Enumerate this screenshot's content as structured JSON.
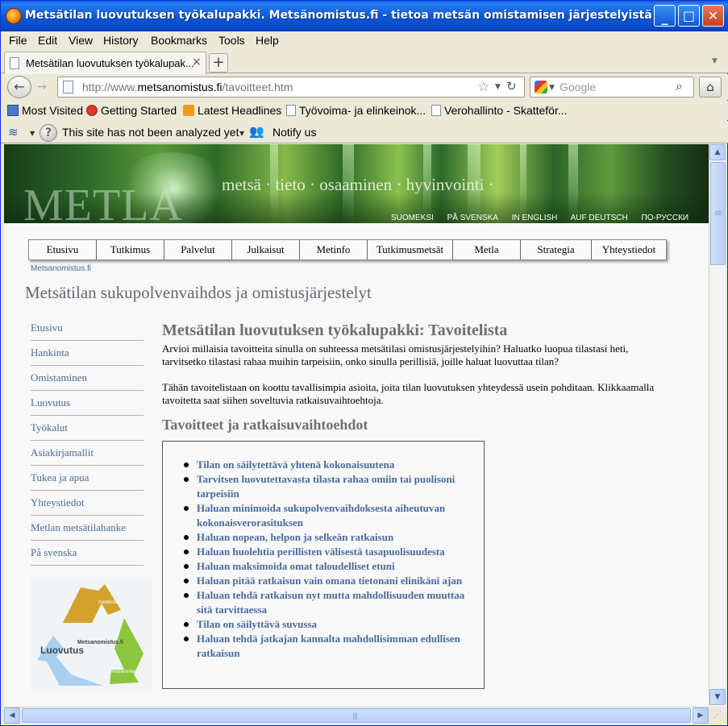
{
  "window": {
    "title": "Metsätilan luovutuksen työkalupakki. Metsänomistus.fi - tietoa metsän omistamisen järjestelyistä - M...",
    "min_glyph": "_",
    "max_glyph": "□",
    "close_glyph": "✕"
  },
  "menu": [
    "File",
    "Edit",
    "View",
    "History",
    "Bookmarks",
    "Tools",
    "Help"
  ],
  "tabs": [
    {
      "label": "Metsätilan luovutuksen työkalupak...",
      "close": "×"
    }
  ],
  "new_tab": "+",
  "navbar": {
    "back": "←",
    "forward": "→",
    "url_prefix": "http://www.",
    "url_domain": "metsanomistus.fi",
    "url_path": "/tavoitteet.htm",
    "star": "☆",
    "reload": "↻",
    "search_placeholder": "Google",
    "search_icon": "⌕",
    "home": "⌂"
  },
  "bookmarks": [
    "Most Visited",
    "Getting Started",
    "Latest Headlines",
    "Työvoima- ja elinkeinok...",
    "Verohallinto - Skatteför..."
  ],
  "addon_bar": {
    "wot_icon": "wifi-icon",
    "status": "This site has not been analyzed yet",
    "notify": "Notify us"
  },
  "banner": {
    "logo": "METLA",
    "tagline": "metsä  ·  tieto  ·  osaaminen  ·  hyvinvointi  ·",
    "languages": [
      "SUOMEKSI",
      "PÅ SVENSKA",
      "IN ENGLISH",
      "AUF DEUTSCH",
      "ПО-РУССКИ"
    ]
  },
  "topnav": [
    "Etusivu",
    "Tutkimus",
    "Palvelut",
    "Julkaisut",
    "Metinfo",
    "Tutkimusmetsät",
    "Metla",
    "Strategia",
    "Yhteystiedot"
  ],
  "breadcrumb": "Metsanomistus.fi",
  "site_title": "Metsätilan sukupolvenvaihdos ja omistusjärjestelyt",
  "sidenav": [
    "Etusivu",
    "Hankinta",
    "Omistaminen",
    "Luovutus",
    "Työkalut",
    "Asiakirjamallit",
    "Tukea ja apua",
    "Yhteystiedot",
    "Metlan metsätilahanke",
    "På svenska"
  ],
  "cycle_logo": {
    "center": "Metsanomistus.fi",
    "hankinta": "Hankinta",
    "luovutus": "Luovutus",
    "omistaminen": "Omistaminen"
  },
  "main": {
    "heading": "Metsätilan luovutuksen työkalupakki: Tavoitelista",
    "intro": "Arvioi millaisia tavoitteita sinulla on suhteessa metsätilasi omistusjärjestelyihin? Haluatko luopua tilastasi heti, tarvitsetko tilastasi rahaa muihin tarpeisiin, onko sinulla perillisiä, joille haluat luovuttaa tilan?",
    "info": "Tähän tavoitelistaan on koottu tavallisimpia asioita, joita tilan luovutuksen yhteydessä usein pohditaan. Klikkaamalla tavoitetta saat siihen soveltuvia ratkaisuvaihtoehtoja.",
    "subheading": "Tavoitteet ja ratkaisuvaihtoehdot",
    "goals": [
      "Tilan on säilytettävä yhtenä kokonaisuutena",
      "Tarvitsen luovutettavasta tilasta rahaa omiin tai puolisoni tarpeisiin",
      "Haluan minimoida sukupolvenvaihdoksesta aiheutuvan kokonaisverorasituksen",
      "Haluan nopean, helpon ja selkeän ratkaisun",
      "Haluan huolehtia perillisten välisestä tasapuolisuudesta",
      "Haluan maksimoida omat taloudelliset etuni",
      "Haluan pitää ratkaisun vain omana tietonani elinikäni ajan",
      "Haluan tehdä ratkaisun nyt mutta mahdollisuuden muuttaa sitä tarvittaessa",
      "Tilan on säilyttävä suvussa",
      "Haluan tehdä jatkajan kannalta mahdollisimman edullisen ratkaisun"
    ]
  },
  "scroll": {
    "up": "▲",
    "down": "▼",
    "left": "◀",
    "right": "▶"
  }
}
